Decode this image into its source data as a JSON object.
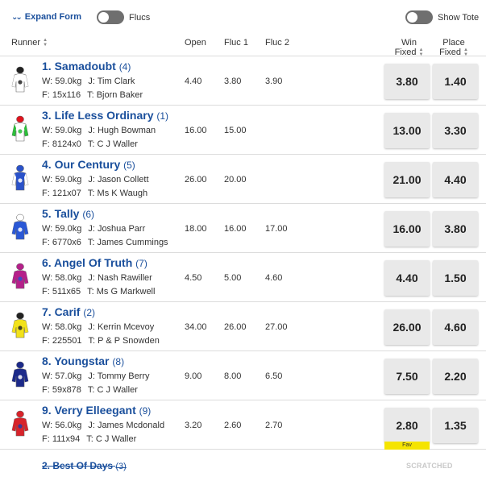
{
  "toolbar": {
    "expand_label": "Expand Form",
    "flucs_label": "Flucs",
    "tote_label": "Show Tote"
  },
  "columns": {
    "runner": "Runner",
    "open": "Open",
    "fluc1": "Fluc 1",
    "fluc2": "Fluc 2",
    "win_1": "Win",
    "win_2": "Fixed",
    "place_1": "Place",
    "place_2": "Fixed"
  },
  "runners": [
    {
      "name": "1. Samadoubt",
      "barrier": "(4)",
      "weight": "W: 59.0kg",
      "jockey": "J: Tim Clark",
      "form": "F: 15x116",
      "trainer": "T: Bjorn Baker",
      "open": "4.40",
      "fluc1": "3.80",
      "fluc2": "3.90",
      "win": "3.80",
      "place": "1.40",
      "silk": {
        "body": "#ffffff",
        "cap": "#222222",
        "sleeve": "#ffffff",
        "accent": "#222222"
      }
    },
    {
      "name": "3. Life Less Ordinary",
      "barrier": "(1)",
      "weight": "W: 59.0kg",
      "jockey": "J: Hugh Bowman",
      "form": "F: 8124x0",
      "trainer": "T: C J Waller",
      "open": "16.00",
      "fluc1": "15.00",
      "fluc2": "",
      "win": "13.00",
      "place": "3.30",
      "silk": {
        "body": "#ffffff",
        "cap": "#e0141e",
        "sleeve": "#2bbf3a",
        "accent": "#2bbf3a"
      }
    },
    {
      "name": "4. Our Century",
      "barrier": "(5)",
      "weight": "W: 59.0kg",
      "jockey": "J: Jason Collett",
      "form": "F: 121x07",
      "trainer": "T: Ms K Waugh",
      "open": "26.00",
      "fluc1": "20.00",
      "fluc2": "",
      "win": "21.00",
      "place": "4.40",
      "silk": {
        "body": "#2a52c9",
        "cap": "#2a52c9",
        "sleeve": "#ffffff",
        "accent": "#ffffff"
      }
    },
    {
      "name": "5. Tally",
      "barrier": "(6)",
      "weight": "W: 59.0kg",
      "jockey": "J: Joshua Parr",
      "form": "F: 6770x6",
      "trainer": "T: James Cummings",
      "open": "18.00",
      "fluc1": "16.00",
      "fluc2": "17.00",
      "win": "16.00",
      "place": "3.80",
      "silk": {
        "body": "#2a58d6",
        "cap": "#ffffff",
        "sleeve": "#2a58d6",
        "accent": "#ffffff"
      }
    },
    {
      "name": "6. Angel Of Truth",
      "barrier": "(7)",
      "weight": "W: 58.0kg",
      "jockey": "J: Nash Rawiller",
      "form": "F: 511x65",
      "trainer": "T: Ms G Markwell",
      "open": "4.50",
      "fluc1": "5.00",
      "fluc2": "4.60",
      "win": "4.40",
      "place": "1.50",
      "silk": {
        "body": "#b5208a",
        "cap": "#b5208a",
        "sleeve": "#b5208a",
        "accent": "#2a52c9"
      }
    },
    {
      "name": "7. Carif",
      "barrier": "(2)",
      "weight": "W: 58.0kg",
      "jockey": "J: Kerrin Mcevoy",
      "form": "F: 225501",
      "trainer": "T: P & P Snowden",
      "open": "34.00",
      "fluc1": "26.00",
      "fluc2": "27.00",
      "win": "26.00",
      "place": "4.60",
      "silk": {
        "body": "#f2e21a",
        "cap": "#222222",
        "sleeve": "#f2e21a",
        "accent": "#222222"
      }
    },
    {
      "name": "8. Youngstar",
      "barrier": "(8)",
      "weight": "W: 57.0kg",
      "jockey": "J: Tommy Berry",
      "form": "F: 59x878",
      "trainer": "T: C J Waller",
      "open": "9.00",
      "fluc1": "8.00",
      "fluc2": "6.50",
      "win": "7.50",
      "place": "2.20",
      "silk": {
        "body": "#1c2a8a",
        "cap": "#1c2a8a",
        "sleeve": "#1c2a8a",
        "accent": "#ffffff"
      }
    },
    {
      "name": "9. Verry Elleegant",
      "barrier": "(9)",
      "weight": "W: 56.0kg",
      "jockey": "J: James Mcdonald",
      "form": "F: 111x94",
      "trainer": "T: C J Waller",
      "open": "3.20",
      "fluc1": "2.60",
      "fluc2": "2.70",
      "win": "2.80",
      "place": "1.35",
      "silk": {
        "body": "#d8232a",
        "cap": "#d8232a",
        "sleeve": "#d8232a",
        "accent": "#1e3aa8"
      }
    }
  ],
  "fav_label": "Fav",
  "scratched": {
    "name": "2. Best Of Days",
    "barrier": "(3)",
    "status": "SCRATCHED"
  },
  "colors": {
    "accent": "#1a4f9c",
    "fav": "#f5e400",
    "price_bg": "#e9e9e9"
  }
}
